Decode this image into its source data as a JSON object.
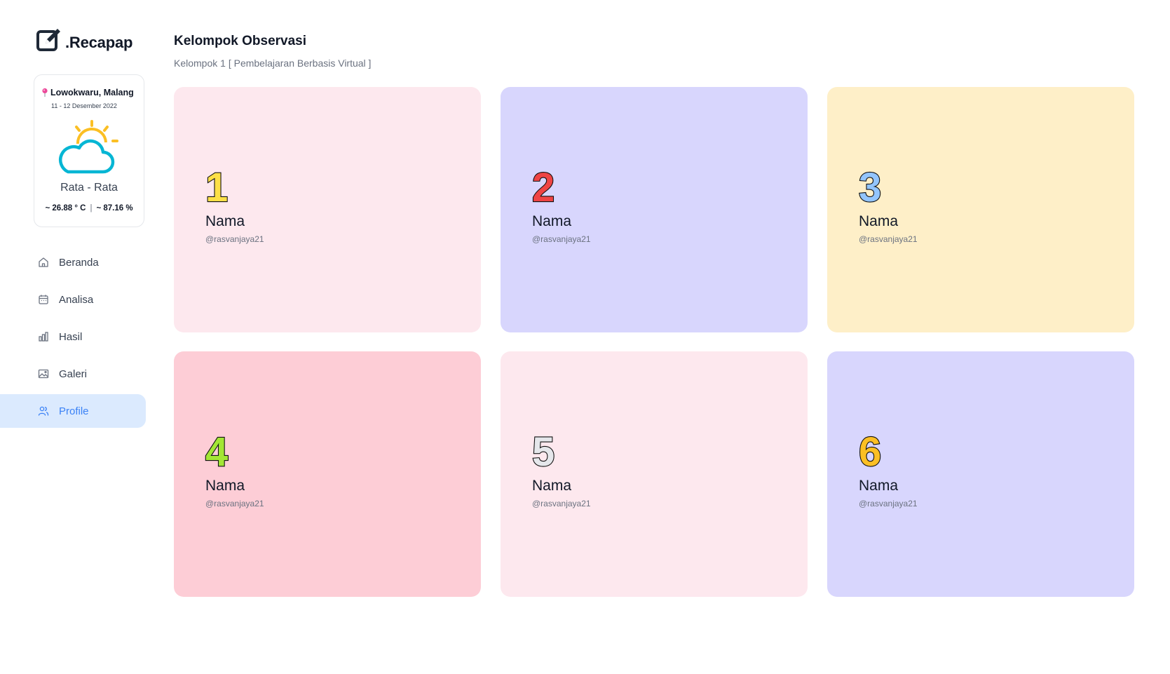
{
  "app": {
    "logo_text": ".Recapap"
  },
  "weather": {
    "location": "Lowokwaru, Malang",
    "date": "11 - 12 Desember 2022",
    "label": "Rata - Rata",
    "temperature": "~ 26.88 ° C",
    "separator": "|",
    "humidity": "~ 87.16 %",
    "icon": "partly-cloudy-icon"
  },
  "nav": {
    "items": [
      {
        "label": "Beranda",
        "icon": "home-icon"
      },
      {
        "label": "Analisa",
        "icon": "calendar-icon"
      },
      {
        "label": "Hasil",
        "icon": "bar-chart-icon"
      },
      {
        "label": "Galeri",
        "icon": "image-icon"
      },
      {
        "label": "Profile",
        "icon": "users-icon",
        "active": true
      }
    ]
  },
  "main": {
    "title": "Kelompok Observasi",
    "subtitle": "Kelompok 1 [ Pembelajaran Berbasis Virtual ]",
    "cards": [
      {
        "number": "1",
        "name": "Nama",
        "handle": "@rasvanjaya21",
        "bg": "#fde8ee",
        "num_color": "#fde047"
      },
      {
        "number": "2",
        "name": "Nama",
        "handle": "@rasvanjaya21",
        "bg": "#d8d6fd",
        "num_color": "#ef4444"
      },
      {
        "number": "3",
        "name": "Nama",
        "handle": "@rasvanjaya21",
        "bg": "#feefc8",
        "num_color": "#93c5fd"
      },
      {
        "number": "4",
        "name": "Nama",
        "handle": "@rasvanjaya21",
        "bg": "#fdcdd6",
        "num_color": "#a3e635"
      },
      {
        "number": "5",
        "name": "Nama",
        "handle": "@rasvanjaya21",
        "bg": "#fde8ee",
        "num_color": "#e5e7eb"
      },
      {
        "number": "6",
        "name": "Nama",
        "handle": "@rasvanjaya21",
        "bg": "#d8d6fd",
        "num_color": "#fbbf24"
      }
    ]
  }
}
